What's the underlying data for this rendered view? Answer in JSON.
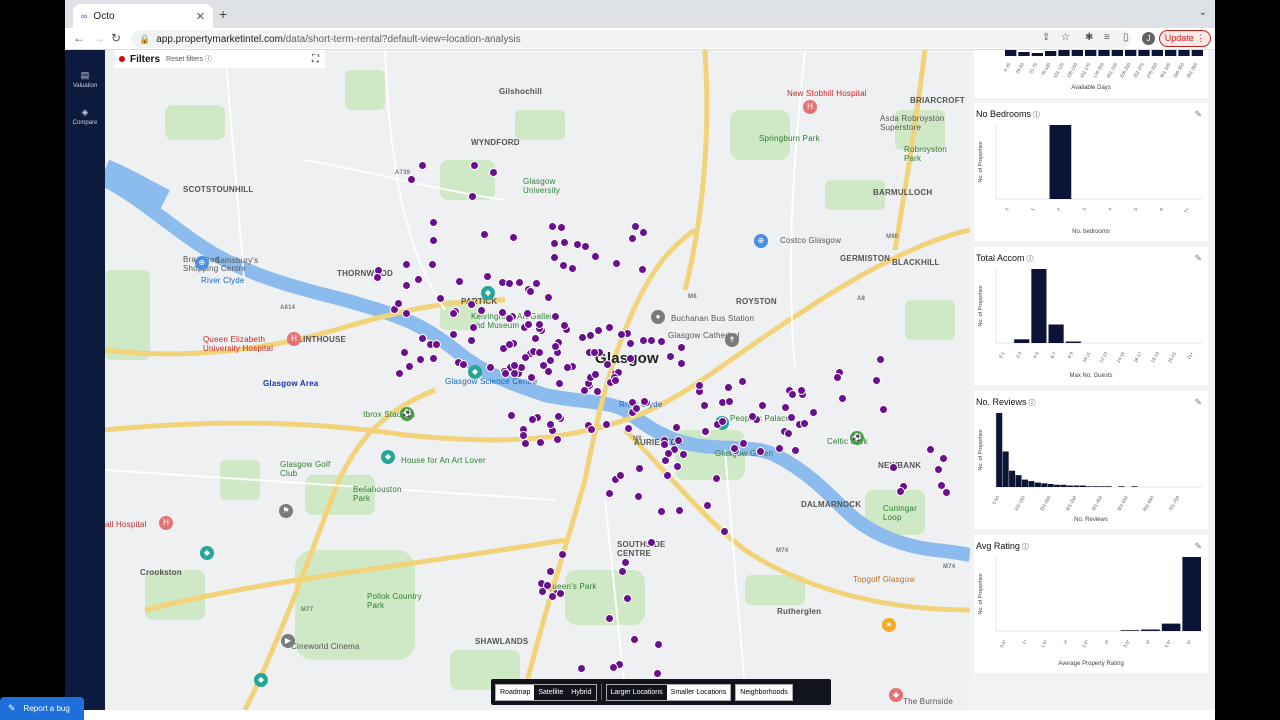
{
  "browser": {
    "tab_title": "Octo",
    "url_host": "app.propertymarketintel.com",
    "url_path": "/data/short-term-rental?default-view=location-analysis",
    "update_label": "Update",
    "avatar_letter": "J"
  },
  "sidenav": {
    "items": [
      {
        "label": "Valuation",
        "icon": "clipboard-icon"
      },
      {
        "label": "Compare",
        "icon": "layers-icon"
      }
    ]
  },
  "filters": {
    "title": "Filters",
    "reset_label": "Reset filters"
  },
  "map": {
    "labels": {
      "gilshochill": "Gilshochill",
      "wyndford": "WYNDFORD",
      "scotstounhill": "SCOTSTOUNHILL",
      "braehead": "Braehead Shopping Centre",
      "sainsburys": "Sainsbury's",
      "thornwood": "THORNWOOD",
      "partick": "PARTICK",
      "kelvingrove": "Kelvingrove Art Gallery and Museum",
      "glasgow_uni": "Glasgow University",
      "river_clyde_w": "River Clyde",
      "river_clyde_c": "River Clyde",
      "linthouse": "LINTHOUSE",
      "qeuh": "Queen Elizabeth University Hospital",
      "glasgow_area": "Glasgow Area",
      "glasgow": "Glasgow",
      "science_centre": "Glasgow Science Centre",
      "ibrox": "Ibrox Stadium",
      "house_art": "House for An Art Lover",
      "golf_club": "Glasgow Golf Club",
      "bellahouston": "Bellahouston Park",
      "hospital_w": "all Hospital",
      "crookston": "Crookston",
      "pollok": "Pollok Country Park",
      "cineworld": "Cineworld Cinema",
      "shawlands": "SHAWLANDS",
      "queens_park": "Queen's Park",
      "southside": "SOUTHSIDE CENTRE",
      "people_palace": "People's Palace",
      "aurieston": "AURIESTON",
      "glasgow_green": "Glasgow Green",
      "dalmarnock": "DALMARNOCK",
      "celtic_park": "Celtic Park",
      "newbank": "NEWBANK",
      "cuningar": "Cuningar Loop",
      "rutherglen": "Rutherglen",
      "topgolf": "Topgolf Glasgow",
      "burnside": "The Burnside",
      "royston": "ROYSTON",
      "buchanan": "Buchanan Bus Station",
      "cathedral": "Glasgow Cathedral",
      "germiston": "GERMISTON",
      "blackhill": "BLACKHILL",
      "costco": "Costco Glasgow",
      "springburn": "Springburn Park",
      "new_stobhill": "New Stobhill Hospital",
      "asda": "Asda Robroyston Superstore",
      "briarcroft": "BRIARCROFT",
      "robroyston": "Robroyston Park",
      "barmulloch": "BARMULLOCH",
      "roads": {
        "a814": "A814",
        "m8": "M8",
        "m8b": "M8",
        "m80": "M80",
        "m74": "M74",
        "m74b": "M74",
        "m77": "M77",
        "a8": "A8",
        "a739": "A739"
      }
    },
    "toolbar": {
      "roadmap": "Roadmap",
      "satellite": "Satellite",
      "hybrid": "Hybrid",
      "larger": "Larger Locations",
      "smaller": "Smaller Locations",
      "neighborhoods": "Neighborhoods"
    },
    "colors": {
      "marker": "#6b0f8e",
      "park": "#c8e6c0",
      "water": "#86b7ec",
      "road_major": "#f6d88f"
    }
  },
  "panel": {
    "available_days": {
      "xlabel": "Available Days",
      "ticks": [
        "0-25",
        "26-50",
        "51-75",
        "76-100",
        "101-125",
        "126-150",
        "151-175",
        "176-200",
        "201-225",
        "226-250",
        "251-275",
        "276-300",
        "301-325",
        "326-350",
        "351-365"
      ]
    },
    "bedrooms": {
      "title": "No Bedrooms",
      "xlabel": "No. bedrooms",
      "ylabel": "No. of Properties"
    },
    "total_accom": {
      "title": "Total Accom",
      "xlabel": "Max No. Guests",
      "ylabel": "No. of Properties"
    },
    "reviews": {
      "title": "No. Reviews",
      "xlabel": "No. Reviews",
      "ylabel": "No. of Properties"
    },
    "avg_rating": {
      "title": "Avg Rating",
      "xlabel": "Average Property Rating",
      "ylabel": "No. of Properties"
    }
  },
  "chart_data": [
    {
      "type": "bar",
      "title": "",
      "xlabel": "Available Days",
      "categories": [
        "0-25",
        "26-50",
        "51-75",
        "76-100",
        "101-125",
        "126-150",
        "151-175",
        "176-200",
        "201-225",
        "226-250",
        "251-275",
        "276-300",
        "301-325",
        "326-350",
        "351-365"
      ],
      "values": [
        6,
        4,
        3,
        5,
        6,
        6,
        6,
        6,
        6,
        6,
        6,
        6,
        6,
        6,
        6
      ]
    },
    {
      "type": "bar",
      "title": "No Bedrooms",
      "xlabel": "No. bedrooms",
      "ylabel": "No. of Properties",
      "categories": [
        "0",
        "1",
        "2",
        "3",
        "4",
        "5",
        "6",
        "7+"
      ],
      "values": [
        0,
        0,
        100,
        0,
        0,
        0,
        0,
        0
      ]
    },
    {
      "type": "bar",
      "title": "Total Accom",
      "xlabel": "Max No. Guests",
      "ylabel": "No. of Properties",
      "categories": [
        "0-1",
        "2-3",
        "4-5",
        "6-7",
        "8-9",
        "10-11",
        "12-13",
        "14-15",
        "16-17",
        "18-19",
        "20-21",
        "21+"
      ],
      "values": [
        0,
        5,
        100,
        25,
        2,
        0,
        0,
        0,
        0,
        0,
        0,
        0
      ]
    },
    {
      "type": "bar",
      "title": "No. Reviews",
      "xlabel": "No. Reviews",
      "ylabel": "No. of Properties",
      "categories": [
        "0-50",
        "101-150",
        "201-250",
        "301-350",
        "401-450",
        "501-550",
        "601-650",
        "701-750"
      ],
      "values": [
        100,
        48,
        22,
        16,
        10,
        8,
        6,
        5,
        4,
        3,
        3,
        2,
        2,
        2,
        1,
        1,
        1,
        1,
        0,
        1,
        0,
        1,
        0,
        0,
        0,
        0,
        0,
        0,
        0,
        0,
        0,
        0
      ]
    },
    {
      "type": "bar",
      "title": "Avg Rating",
      "xlabel": "Average Property Rating",
      "ylabel": "No. of Properties",
      "categories": [
        "0.5*",
        "1*",
        "1.5*",
        "2*",
        "2.5*",
        "3*",
        "3.5*",
        "4*",
        "4.5*",
        "5*"
      ],
      "values": [
        0,
        0,
        0,
        0,
        0,
        0,
        1,
        2,
        10,
        100
      ]
    }
  ],
  "report_bug": "Report a bug"
}
